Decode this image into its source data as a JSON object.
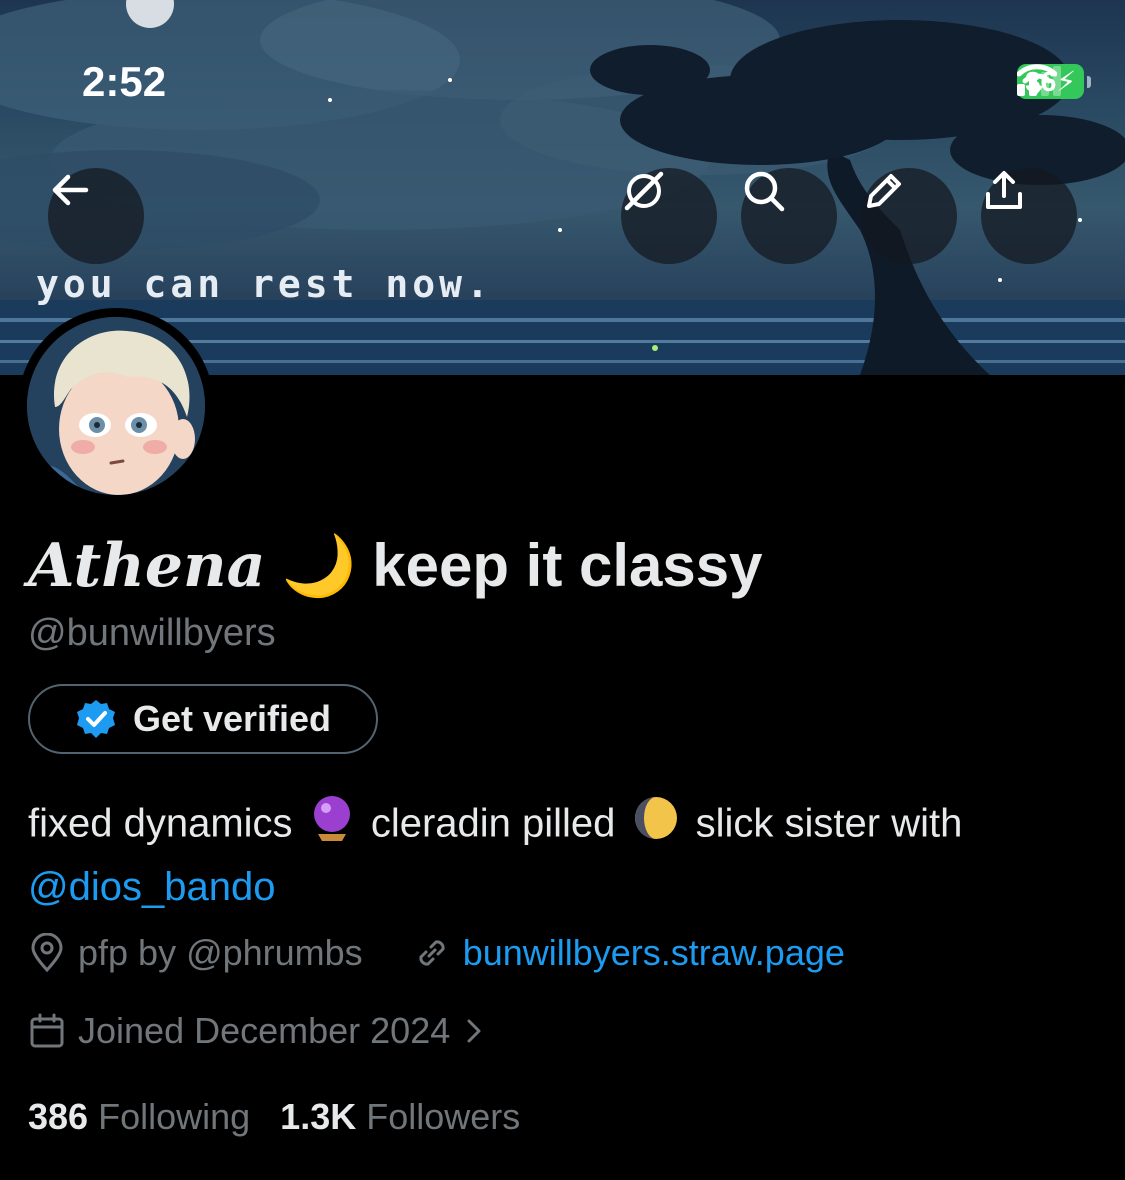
{
  "status_bar": {
    "time": "2:52",
    "battery": "36"
  },
  "banner": {
    "text": "you can rest now."
  },
  "toolbar": {
    "back_icon": "arrow-left-icon",
    "grok_icon": "grok-icon",
    "search_icon": "search-icon",
    "edit_icon": "pencil-icon",
    "share_icon": "share-icon"
  },
  "profile": {
    "display_name_script": "Athena",
    "display_name_emoji": "🌙",
    "display_name_rest": "keep it classy",
    "handle": "@bunwillbyers",
    "get_verified_label": "Get verified",
    "bio_part1": "fixed dynamics",
    "bio_part2": "cleradin pilled",
    "bio_part3": "slick sister with",
    "bio_mention": "@dios_bando",
    "location": "pfp by @phrumbs",
    "website": "bunwillbyers.straw.page",
    "joined": "Joined December 2024",
    "following_count": "386",
    "following_label": "Following",
    "followers_count": "1.3K",
    "followers_label": "Followers"
  },
  "colors": {
    "accent": "#1d9bf0",
    "muted": "#71767b",
    "battery": "#34c759"
  }
}
